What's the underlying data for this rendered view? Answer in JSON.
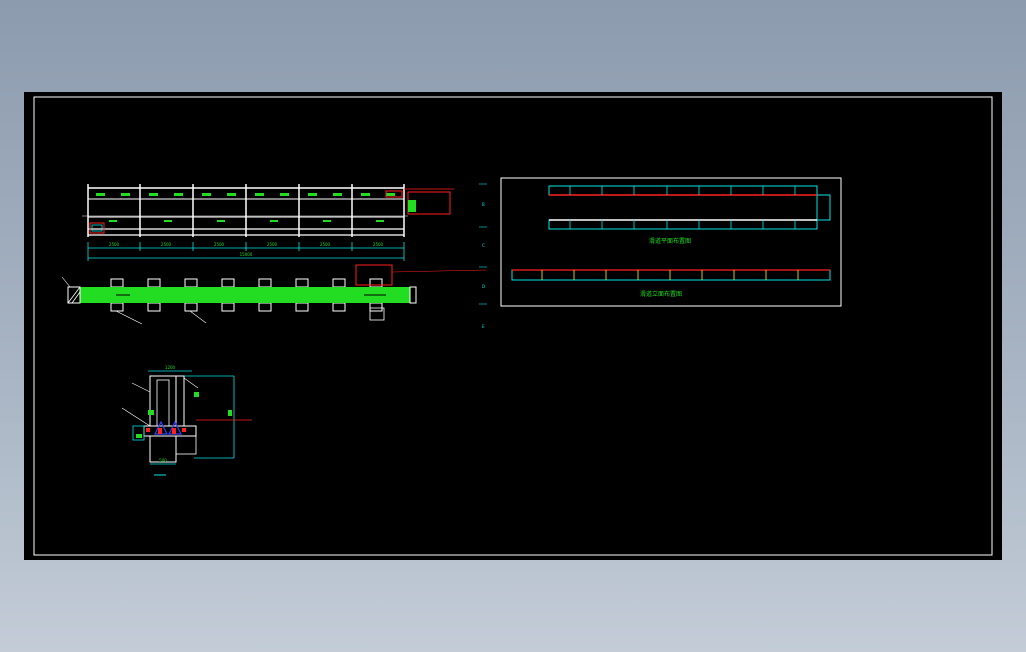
{
  "colors": {
    "background": "#000000",
    "frame": "#ffffff",
    "structure": "#ffffff",
    "cyan": "#00e5e5",
    "green": "#22dd22",
    "red": "#ff2020",
    "yellow": "#ffff00",
    "blue": "#3040ff"
  },
  "elevation": {
    "overall_dim": "15000",
    "bay_dims": [
      "2500",
      "2500",
      "2500",
      "2500",
      "2500",
      "2500"
    ]
  },
  "side_labels": [
    "B",
    "C",
    "D",
    "E"
  ],
  "section": {
    "top_dim": "1200",
    "bottom_dim": "500"
  },
  "plan_view": {
    "caption_top": "滑道平面布置图",
    "caption_bottom": "滑道立面布置图"
  }
}
